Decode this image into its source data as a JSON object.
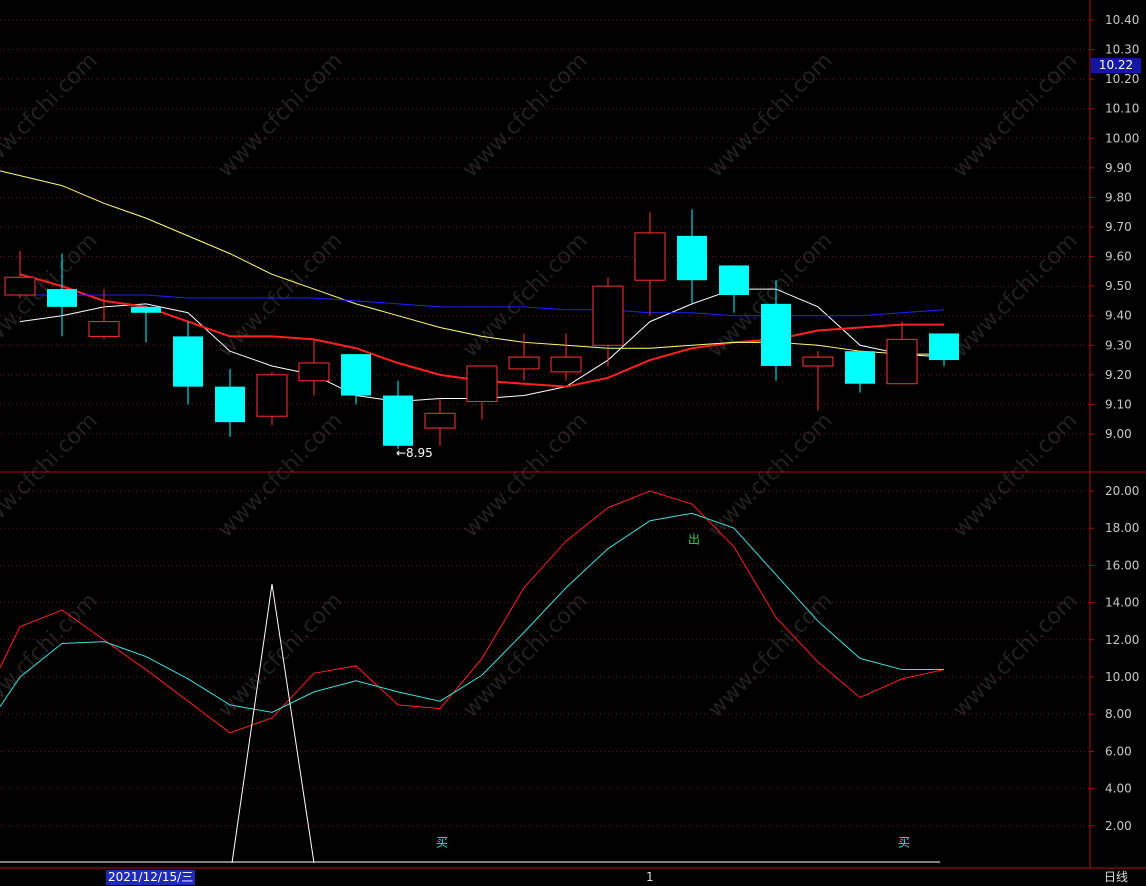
{
  "chart_data": [
    {
      "type": "candlestick",
      "panel": "price",
      "ylim": [
        8.92,
        10.45
      ],
      "yticks": [
        "10.40",
        "10.30",
        "10.20",
        "10.10",
        "10.00",
        "9.90",
        "9.80",
        "9.70",
        "9.60",
        "9.50",
        "9.40",
        "9.30",
        "9.20",
        "9.10",
        "9.00"
      ],
      "current_price": "10.22",
      "low_marker": "←8.95",
      "candles": [
        {
          "open": 9.47,
          "close": 9.53,
          "high": 9.62,
          "low": 9.46,
          "color": "up"
        },
        {
          "open": 9.49,
          "close": 9.43,
          "high": 9.61,
          "low": 9.33,
          "color": "down"
        },
        {
          "open": 9.33,
          "close": 9.38,
          "high": 9.49,
          "low": 9.32,
          "color": "up"
        },
        {
          "open": 9.43,
          "close": 9.41,
          "high": 9.43,
          "low": 9.31,
          "color": "down"
        },
        {
          "open": 9.33,
          "close": 9.16,
          "high": 9.38,
          "low": 9.1,
          "color": "down"
        },
        {
          "open": 9.16,
          "close": 9.04,
          "high": 9.22,
          "low": 8.99,
          "color": "down"
        },
        {
          "open": 9.06,
          "close": 9.2,
          "high": 9.21,
          "low": 9.03,
          "color": "up"
        },
        {
          "open": 9.18,
          "close": 9.24,
          "high": 9.32,
          "low": 9.13,
          "color": "up"
        },
        {
          "open": 9.27,
          "close": 9.13,
          "high": 9.27,
          "low": 9.1,
          "color": "down"
        },
        {
          "open": 9.13,
          "close": 8.96,
          "high": 9.18,
          "low": 8.95,
          "color": "down"
        },
        {
          "open": 9.02,
          "close": 9.07,
          "high": 9.12,
          "low": 8.96,
          "color": "up"
        },
        {
          "open": 9.11,
          "close": 9.23,
          "high": 9.23,
          "low": 9.05,
          "color": "up"
        },
        {
          "open": 9.22,
          "close": 9.26,
          "high": 9.34,
          "low": 9.18,
          "color": "up"
        },
        {
          "open": 9.21,
          "close": 9.26,
          "high": 9.34,
          "low": 9.18,
          "color": "up"
        },
        {
          "open": 9.3,
          "close": 9.5,
          "high": 9.53,
          "low": 9.23,
          "color": "up"
        },
        {
          "open": 9.52,
          "close": 9.68,
          "high": 9.75,
          "low": 9.4,
          "color": "up"
        },
        {
          "open": 9.67,
          "close": 9.52,
          "high": 9.76,
          "low": 9.44,
          "color": "down"
        },
        {
          "open": 9.57,
          "close": 9.47,
          "high": 9.57,
          "low": 9.41,
          "color": "down"
        },
        {
          "open": 9.44,
          "close": 9.23,
          "high": 9.52,
          "low": 9.18,
          "color": "down"
        },
        {
          "open": 9.23,
          "close": 9.26,
          "high": 9.28,
          "low": 9.08,
          "color": "up"
        },
        {
          "open": 9.28,
          "close": 9.17,
          "high": 9.28,
          "low": 9.14,
          "color": "down"
        },
        {
          "open": 9.17,
          "close": 9.32,
          "high": 9.38,
          "low": 9.17,
          "color": "up"
        },
        {
          "open": 9.34,
          "close": 9.25,
          "high": 9.34,
          "low": 9.23,
          "color": "down"
        }
      ],
      "series": [
        {
          "color": "#ffffff",
          "values": [
            9.38,
            9.4,
            9.43,
            9.44,
            9.41,
            9.28,
            9.23,
            9.2,
            9.13,
            9.11,
            9.12,
            9.12,
            9.13,
            9.16,
            9.25,
            9.38,
            9.44,
            9.49,
            9.49,
            9.43,
            9.3,
            9.27,
            9.26
          ]
        },
        {
          "color": "#ff2020",
          "values": [
            9.54,
            9.5,
            9.45,
            9.43,
            9.38,
            9.33,
            9.33,
            9.32,
            9.29,
            9.24,
            9.2,
            9.18,
            9.17,
            9.16,
            9.19,
            9.25,
            9.29,
            9.31,
            9.32,
            9.35,
            9.36,
            9.37,
            9.37
          ]
        },
        {
          "color": "#ffff80",
          "values": [
            9.89,
            9.84,
            9.78,
            9.73,
            9.67,
            9.61,
            9.54,
            9.49,
            9.44,
            9.4,
            9.36,
            9.33,
            9.31,
            9.3,
            9.29,
            9.29,
            9.3,
            9.31,
            9.31,
            9.3,
            9.28,
            9.27,
            9.27
          ]
        },
        {
          "color": "#2020ff",
          "values": [
            9.47,
            9.47,
            9.47,
            9.47,
            9.46,
            9.46,
            9.46,
            9.46,
            9.45,
            9.44,
            9.43,
            9.43,
            9.43,
            9.42,
            9.42,
            9.41,
            9.41,
            9.4,
            9.4,
            9.4,
            9.4,
            9.41,
            9.42
          ]
        }
      ]
    },
    {
      "type": "line",
      "panel": "indicator",
      "ylim": [
        0,
        21.2
      ],
      "yticks": [
        "20.00",
        "18.00",
        "16.00",
        "14.00",
        "12.00",
        "10.00",
        "8.00",
        "6.00",
        "4.00",
        "2.00"
      ],
      "series": [
        {
          "color": "#ff2020",
          "values": [
            12.7,
            13.6,
            12.0,
            10.4,
            8.7,
            7.0,
            7.8,
            10.2,
            10.6,
            8.5,
            8.3,
            11.0,
            14.8,
            17.3,
            19.1,
            20.0,
            19.3,
            17.0,
            13.2,
            10.8,
            8.9,
            9.9,
            10.4
          ]
        },
        {
          "color": "#40e0e0",
          "values": [
            10.0,
            11.8,
            11.9,
            11.1,
            9.9,
            8.5,
            8.1,
            9.2,
            9.8,
            9.2,
            8.7,
            10.1,
            12.4,
            14.8,
            16.9,
            18.4,
            18.8,
            18.0,
            15.5,
            13.0,
            11.0,
            10.4,
            10.4
          ]
        },
        {
          "color": "#ffffff",
          "values": [
            0,
            0,
            0,
            0,
            0,
            0,
            15.0,
            0,
            0,
            0,
            0,
            0,
            0,
            0,
            0,
            0,
            0,
            0,
            0,
            0,
            0,
            0,
            0
          ]
        }
      ],
      "signals": [
        {
          "label": "出",
          "index": 16,
          "value": 17.4,
          "color": "#30d050"
        },
        {
          "label": "买",
          "index": 10,
          "value": 1.1,
          "color": "#40e0e0"
        },
        {
          "label": "买",
          "index": 21,
          "value": 1.1,
          "color": "#40e0e0"
        }
      ]
    }
  ],
  "footer": {
    "date": "2021/12/15/三",
    "marker": "1",
    "period": "日线"
  },
  "watermark": "www.cfchi.com"
}
